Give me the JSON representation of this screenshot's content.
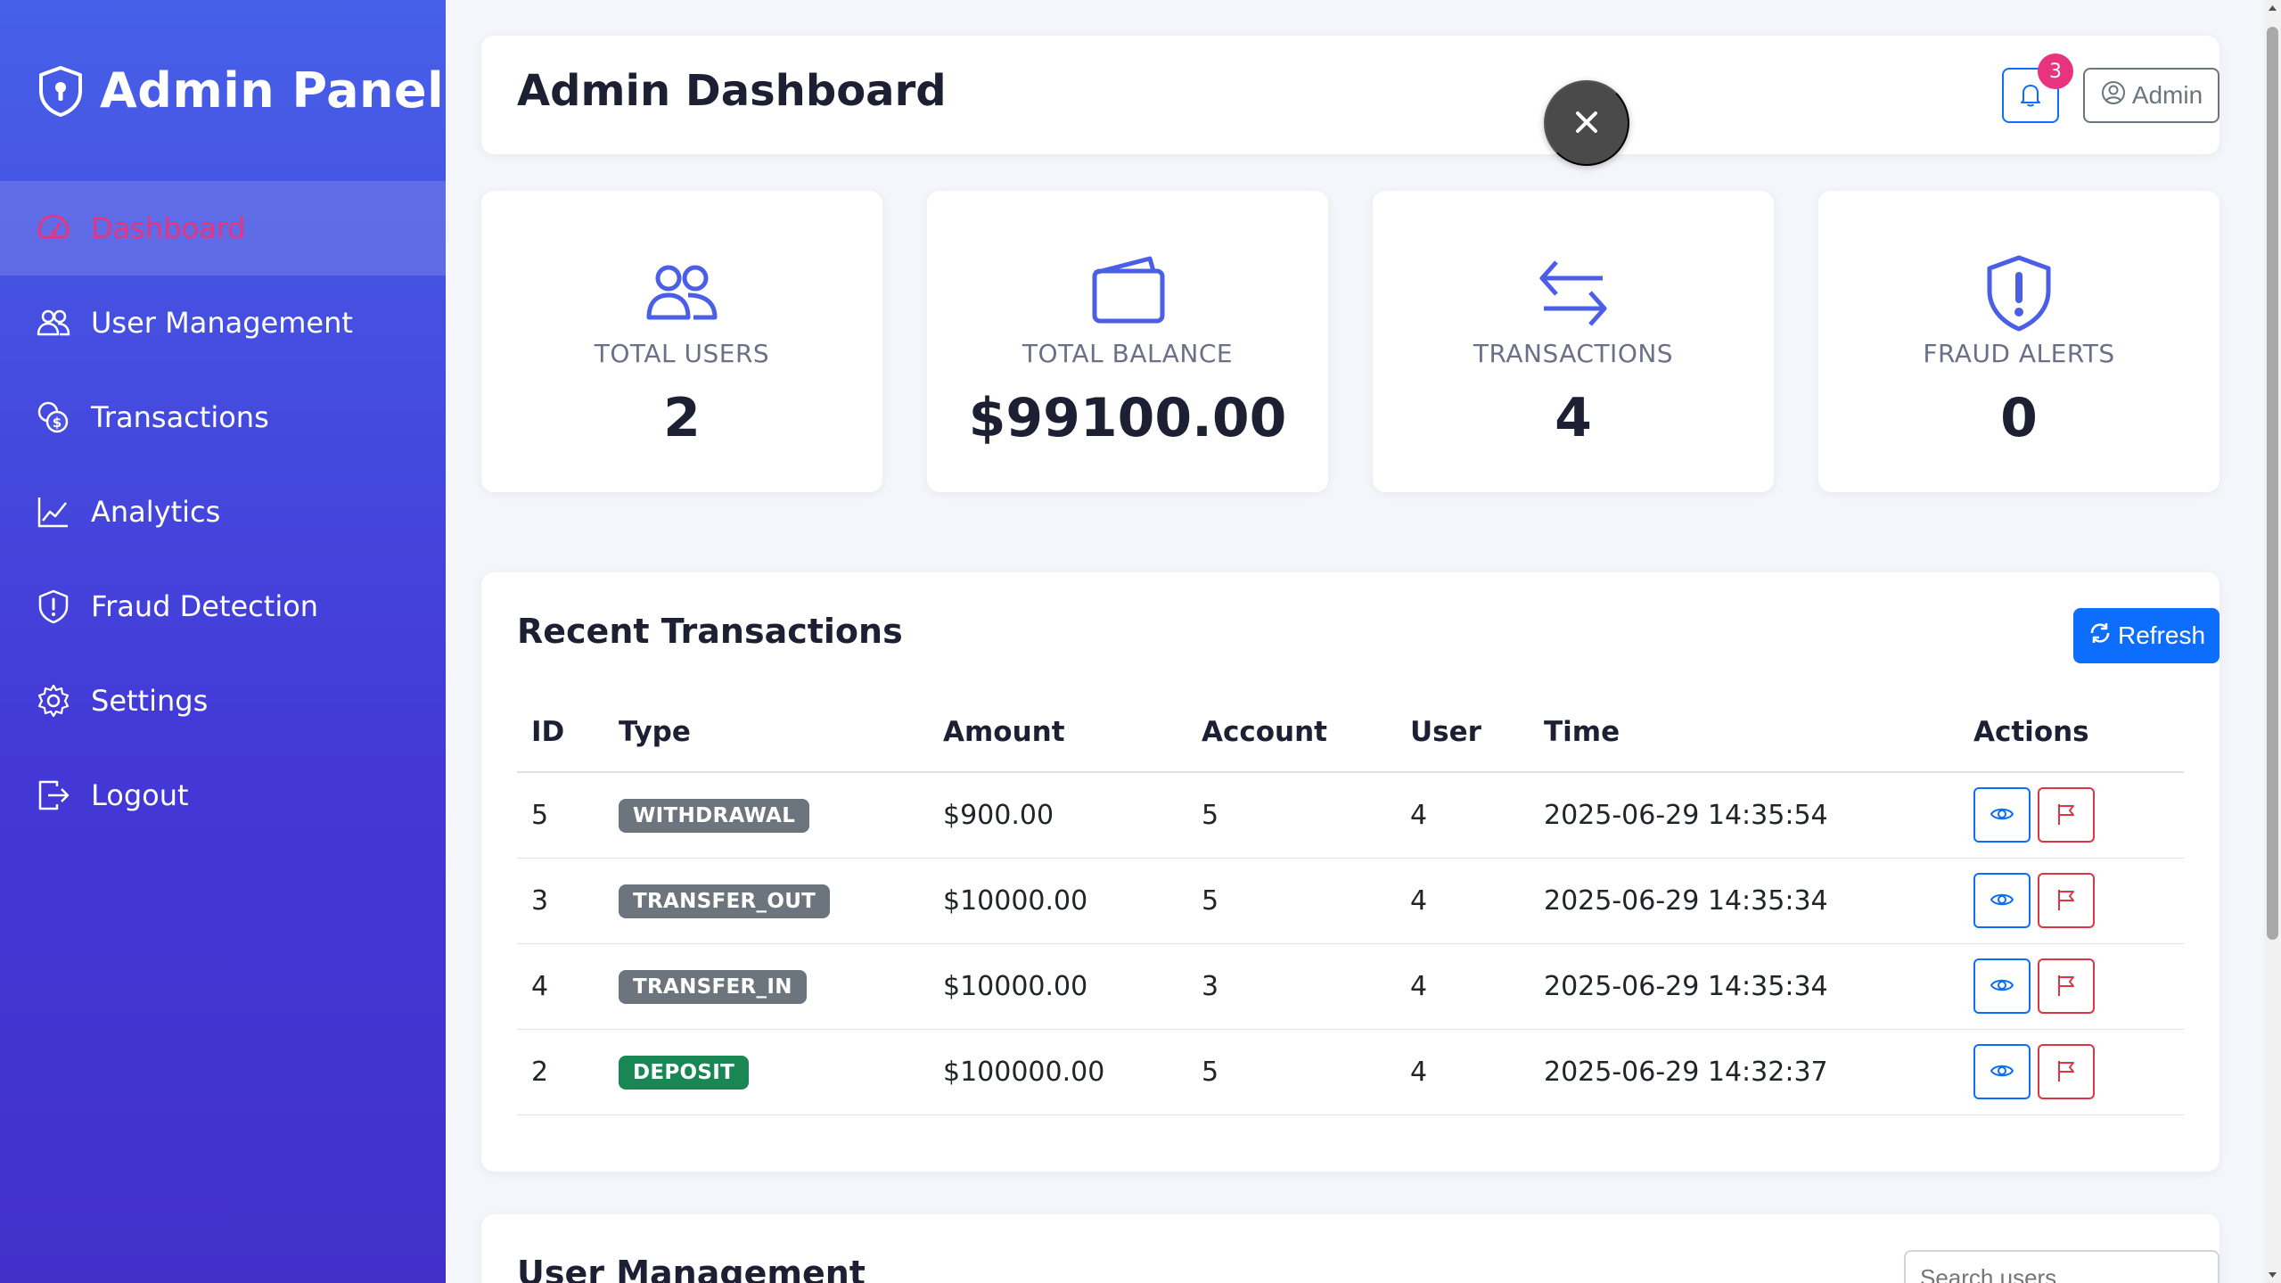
{
  "sidebar": {
    "brand": "Admin Panel",
    "items": [
      {
        "label": "Dashboard",
        "icon": "speedometer-icon",
        "active": true
      },
      {
        "label": "User Management",
        "icon": "people-icon",
        "active": false
      },
      {
        "label": "Transactions",
        "icon": "coins-icon",
        "active": false
      },
      {
        "label": "Analytics",
        "icon": "graph-up-icon",
        "active": false
      },
      {
        "label": "Fraud Detection",
        "icon": "shield-exclamation-icon",
        "active": false
      },
      {
        "label": "Settings",
        "icon": "gear-icon",
        "active": false
      },
      {
        "label": "Logout",
        "icon": "box-arrow-right-icon",
        "active": false
      }
    ]
  },
  "header": {
    "title": "Admin Dashboard",
    "notification_count": "3",
    "user_label": "Admin"
  },
  "stats": [
    {
      "label": "TOTAL USERS",
      "value": "2",
      "icon": "people-icon"
    },
    {
      "label": "TOTAL BALANCE",
      "value": "$99100.00",
      "icon": "wallet-icon"
    },
    {
      "label": "TRANSACTIONS",
      "value": "4",
      "icon": "arrow-left-right-icon"
    },
    {
      "label": "FRAUD ALERTS",
      "value": "0",
      "icon": "shield-exclamation-icon"
    }
  ],
  "transactions": {
    "title": "Recent Transactions",
    "refresh_label": "Refresh",
    "columns": [
      "ID",
      "Type",
      "Amount",
      "Account",
      "User",
      "Time",
      "Actions"
    ],
    "rows": [
      {
        "id": "5",
        "type": "WITHDRAWAL",
        "amount": "$900.00",
        "account": "5",
        "user": "4",
        "time": "2025-06-29 14:35:54"
      },
      {
        "id": "3",
        "type": "TRANSFER_OUT",
        "amount": "$10000.00",
        "account": "5",
        "user": "4",
        "time": "2025-06-29 14:35:34"
      },
      {
        "id": "4",
        "type": "TRANSFER_IN",
        "amount": "$10000.00",
        "account": "3",
        "user": "4",
        "time": "2025-06-29 14:35:34"
      },
      {
        "id": "2",
        "type": "DEPOSIT",
        "amount": "$100000.00",
        "account": "5",
        "user": "4",
        "time": "2025-06-29 14:32:37"
      }
    ]
  },
  "user_management": {
    "title": "User Management",
    "search_placeholder": "Search users..."
  },
  "colors": {
    "primary": "#0d6efd",
    "danger": "#dc3545",
    "accent_pink": "#e8337f",
    "icon_blue": "#4a5ee6",
    "badge_secondary": "#6c757d",
    "badge_success": "#198754"
  }
}
